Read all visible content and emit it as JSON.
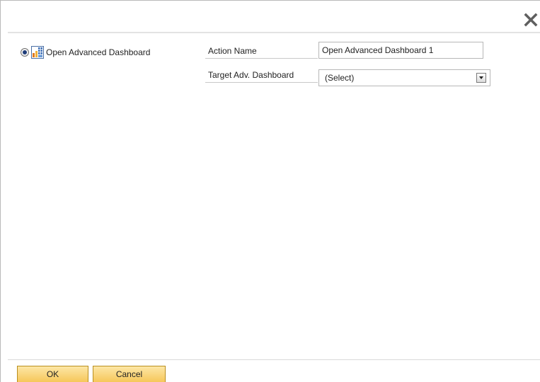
{
  "dialog": {
    "close_icon": "close-x-icon"
  },
  "option": {
    "selected": true,
    "icon": "dashboard-icon",
    "label": "Open Advanced Dashboard"
  },
  "form": {
    "action_name_label": "Action Name",
    "action_name_value": "Open Advanced Dashboard 1",
    "target_label": "Target Adv. Dashboard",
    "target_value": "(Select)"
  },
  "buttons": {
    "ok_label": "OK",
    "cancel_label": "Cancel"
  },
  "colors": {
    "button_fill": "#f6c75a",
    "button_border": "#b98e1e",
    "radio_dot": "#1f3d7a"
  }
}
